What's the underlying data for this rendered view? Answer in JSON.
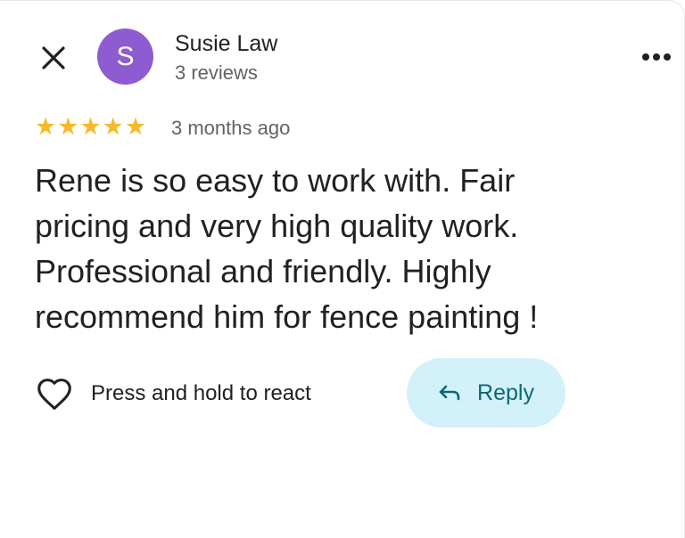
{
  "reviewer": {
    "avatar_letter": "S",
    "avatar_color": "#8e5cd0",
    "name": "Susie Law",
    "review_count": "3 reviews"
  },
  "review": {
    "rating": 5,
    "rating_max": 5,
    "star_color": "#f7b92a",
    "star_glyph": "★",
    "date": "3 months ago",
    "text": "Rene is so easy to work with.   Fair\npricing and very high quality work.\nProfessional and friendly.  Highly\nrecommend him for fence painting !"
  },
  "actions": {
    "react_label": "Press and hold to react",
    "reply_label": "Reply",
    "reply_bg_color": "#d3f1f8",
    "reply_text_color": "#0b6778"
  },
  "icons": {
    "close": "close-icon",
    "more": "more-horizontal-icon",
    "heart": "heart-outline-icon",
    "reply": "reply-arrow-icon"
  }
}
